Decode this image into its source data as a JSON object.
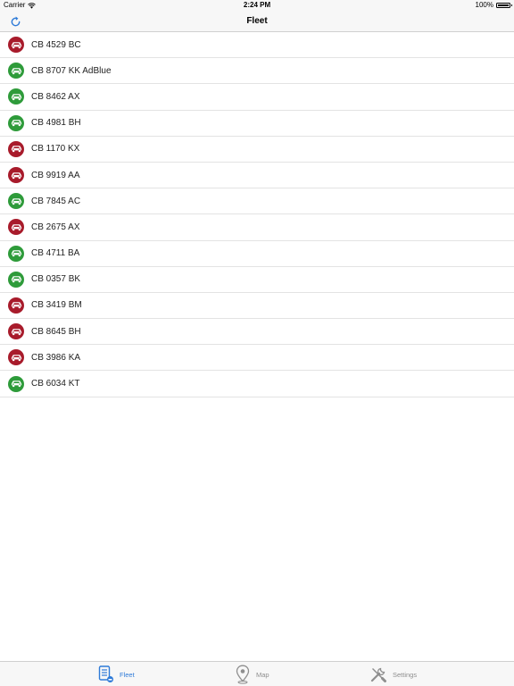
{
  "status_bar": {
    "carrier": "Carrier",
    "time": "2:24 PM",
    "battery": "100%",
    "battery_level": 1.0
  },
  "nav": {
    "title": "Fleet",
    "refresh_icon": "refresh-icon"
  },
  "colors": {
    "online": "#2e9b3a",
    "offline": "#a81b2b",
    "accent": "#2f7bd8"
  },
  "vehicles": [
    {
      "plate": "CB 4529 BC",
      "status": "offline"
    },
    {
      "plate": "CB 8707 KK AdBlue",
      "status": "online"
    },
    {
      "plate": "CB 8462 AX",
      "status": "online"
    },
    {
      "plate": "CB 4981 BH",
      "status": "online"
    },
    {
      "plate": "CB 1170 KX",
      "status": "offline"
    },
    {
      "plate": "CB 9919 AA",
      "status": "offline"
    },
    {
      "plate": "CB 7845 AC",
      "status": "online"
    },
    {
      "plate": "CB 2675 AX",
      "status": "offline"
    },
    {
      "plate": "CB 4711 BA",
      "status": "online"
    },
    {
      "plate": "CB 0357 BK",
      "status": "online"
    },
    {
      "plate": "CB 3419 BM",
      "status": "offline"
    },
    {
      "plate": "CB 8645 BH",
      "status": "offline"
    },
    {
      "plate": "CB 3986 KA",
      "status": "offline"
    },
    {
      "plate": "CB 6034 KT",
      "status": "online"
    }
  ],
  "tabs": [
    {
      "label": "Fleet",
      "icon": "list-document-icon",
      "active": true
    },
    {
      "label": "Map",
      "icon": "map-pin-icon",
      "active": false
    },
    {
      "label": "Settings",
      "icon": "tools-icon",
      "active": false
    }
  ]
}
